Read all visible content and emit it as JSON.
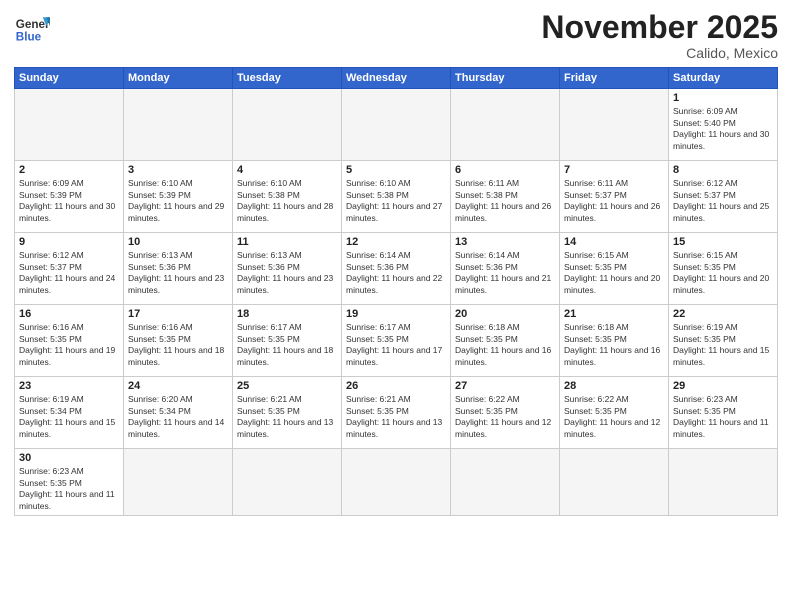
{
  "logo": {
    "text_general": "General",
    "text_blue": "Blue"
  },
  "title": "November 2025",
  "subtitle": "Calido, Mexico",
  "header_days": [
    "Sunday",
    "Monday",
    "Tuesday",
    "Wednesday",
    "Thursday",
    "Friday",
    "Saturday"
  ],
  "weeks": [
    [
      {
        "day": "",
        "empty": true
      },
      {
        "day": "",
        "empty": true
      },
      {
        "day": "",
        "empty": true
      },
      {
        "day": "",
        "empty": true
      },
      {
        "day": "",
        "empty": true
      },
      {
        "day": "",
        "empty": true
      },
      {
        "day": "1",
        "sunrise": "6:09 AM",
        "sunset": "5:40 PM",
        "daylight": "11 hours and 30 minutes."
      }
    ],
    [
      {
        "day": "2",
        "sunrise": "6:09 AM",
        "sunset": "5:39 PM",
        "daylight": "11 hours and 30 minutes."
      },
      {
        "day": "3",
        "sunrise": "6:10 AM",
        "sunset": "5:39 PM",
        "daylight": "11 hours and 29 minutes."
      },
      {
        "day": "4",
        "sunrise": "6:10 AM",
        "sunset": "5:38 PM",
        "daylight": "11 hours and 28 minutes."
      },
      {
        "day": "5",
        "sunrise": "6:10 AM",
        "sunset": "5:38 PM",
        "daylight": "11 hours and 27 minutes."
      },
      {
        "day": "6",
        "sunrise": "6:11 AM",
        "sunset": "5:38 PM",
        "daylight": "11 hours and 26 minutes."
      },
      {
        "day": "7",
        "sunrise": "6:11 AM",
        "sunset": "5:37 PM",
        "daylight": "11 hours and 26 minutes."
      },
      {
        "day": "8",
        "sunrise": "6:12 AM",
        "sunset": "5:37 PM",
        "daylight": "11 hours and 25 minutes."
      }
    ],
    [
      {
        "day": "9",
        "sunrise": "6:12 AM",
        "sunset": "5:37 PM",
        "daylight": "11 hours and 24 minutes."
      },
      {
        "day": "10",
        "sunrise": "6:13 AM",
        "sunset": "5:36 PM",
        "daylight": "11 hours and 23 minutes."
      },
      {
        "day": "11",
        "sunrise": "6:13 AM",
        "sunset": "5:36 PM",
        "daylight": "11 hours and 23 minutes."
      },
      {
        "day": "12",
        "sunrise": "6:14 AM",
        "sunset": "5:36 PM",
        "daylight": "11 hours and 22 minutes."
      },
      {
        "day": "13",
        "sunrise": "6:14 AM",
        "sunset": "5:36 PM",
        "daylight": "11 hours and 21 minutes."
      },
      {
        "day": "14",
        "sunrise": "6:15 AM",
        "sunset": "5:35 PM",
        "daylight": "11 hours and 20 minutes."
      },
      {
        "day": "15",
        "sunrise": "6:15 AM",
        "sunset": "5:35 PM",
        "daylight": "11 hours and 20 minutes."
      }
    ],
    [
      {
        "day": "16",
        "sunrise": "6:16 AM",
        "sunset": "5:35 PM",
        "daylight": "11 hours and 19 minutes."
      },
      {
        "day": "17",
        "sunrise": "6:16 AM",
        "sunset": "5:35 PM",
        "daylight": "11 hours and 18 minutes."
      },
      {
        "day": "18",
        "sunrise": "6:17 AM",
        "sunset": "5:35 PM",
        "daylight": "11 hours and 18 minutes."
      },
      {
        "day": "19",
        "sunrise": "6:17 AM",
        "sunset": "5:35 PM",
        "daylight": "11 hours and 17 minutes."
      },
      {
        "day": "20",
        "sunrise": "6:18 AM",
        "sunset": "5:35 PM",
        "daylight": "11 hours and 16 minutes."
      },
      {
        "day": "21",
        "sunrise": "6:18 AM",
        "sunset": "5:35 PM",
        "daylight": "11 hours and 16 minutes."
      },
      {
        "day": "22",
        "sunrise": "6:19 AM",
        "sunset": "5:35 PM",
        "daylight": "11 hours and 15 minutes."
      }
    ],
    [
      {
        "day": "23",
        "sunrise": "6:19 AM",
        "sunset": "5:34 PM",
        "daylight": "11 hours and 15 minutes."
      },
      {
        "day": "24",
        "sunrise": "6:20 AM",
        "sunset": "5:34 PM",
        "daylight": "11 hours and 14 minutes."
      },
      {
        "day": "25",
        "sunrise": "6:21 AM",
        "sunset": "5:35 PM",
        "daylight": "11 hours and 13 minutes."
      },
      {
        "day": "26",
        "sunrise": "6:21 AM",
        "sunset": "5:35 PM",
        "daylight": "11 hours and 13 minutes."
      },
      {
        "day": "27",
        "sunrise": "6:22 AM",
        "sunset": "5:35 PM",
        "daylight": "11 hours and 12 minutes."
      },
      {
        "day": "28",
        "sunrise": "6:22 AM",
        "sunset": "5:35 PM",
        "daylight": "11 hours and 12 minutes."
      },
      {
        "day": "29",
        "sunrise": "6:23 AM",
        "sunset": "5:35 PM",
        "daylight": "11 hours and 11 minutes."
      }
    ],
    [
      {
        "day": "30",
        "sunrise": "6:23 AM",
        "sunset": "5:35 PM",
        "daylight": "11 hours and 11 minutes.",
        "last": true
      },
      {
        "day": "",
        "empty": true,
        "last": true
      },
      {
        "day": "",
        "empty": true,
        "last": true
      },
      {
        "day": "",
        "empty": true,
        "last": true
      },
      {
        "day": "",
        "empty": true,
        "last": true
      },
      {
        "day": "",
        "empty": true,
        "last": true
      },
      {
        "day": "",
        "empty": true,
        "last": true
      }
    ]
  ]
}
